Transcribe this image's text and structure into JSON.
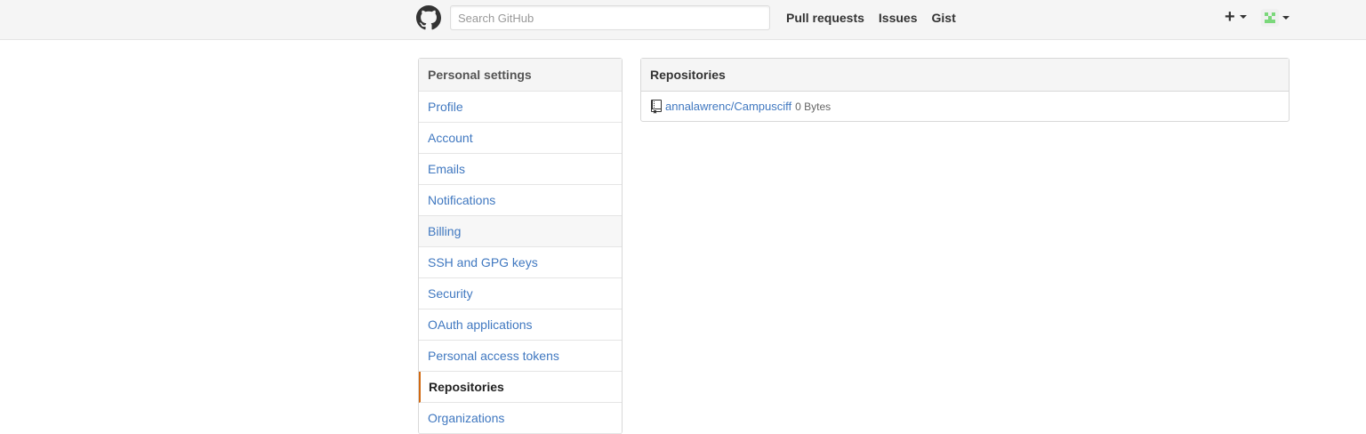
{
  "header": {
    "search_placeholder": "Search GitHub",
    "nav": [
      "Pull requests",
      "Issues",
      "Gist"
    ],
    "plus_label": "+"
  },
  "sidebar": {
    "heading": "Personal settings",
    "items": [
      {
        "label": "Profile",
        "state": "normal"
      },
      {
        "label": "Account",
        "state": "normal"
      },
      {
        "label": "Emails",
        "state": "normal"
      },
      {
        "label": "Notifications",
        "state": "normal"
      },
      {
        "label": "Billing",
        "state": "hovered"
      },
      {
        "label": "SSH and GPG keys",
        "state": "normal"
      },
      {
        "label": "Security",
        "state": "normal"
      },
      {
        "label": "OAuth applications",
        "state": "normal"
      },
      {
        "label": "Personal access tokens",
        "state": "normal"
      },
      {
        "label": "Repositories",
        "state": "selected"
      },
      {
        "label": "Organizations",
        "state": "normal"
      }
    ]
  },
  "main": {
    "title": "Repositories",
    "repos": [
      {
        "name": "annalawrenc/Campusciff",
        "size": "0 Bytes"
      }
    ]
  },
  "colors": {
    "link": "#4078c0",
    "selected_accent": "#d26911",
    "header_bg": "#f5f5f5",
    "avatar": "#7bd87b"
  },
  "icons": {
    "logo": "github-octocat-icon",
    "repo": "repo-book-icon",
    "plus": "plus-icon",
    "caret": "caret-down-icon"
  }
}
